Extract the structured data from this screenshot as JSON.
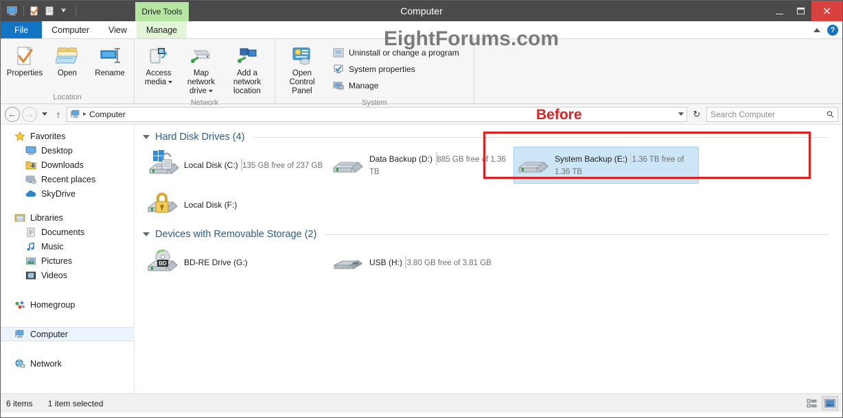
{
  "window": {
    "title": "Computer",
    "contextual_tab": "Drive Tools",
    "watermark": "EightForums.com",
    "minimize": "minimize-button",
    "maximize": "maximize-button",
    "close": "×"
  },
  "tabs": [
    {
      "label": "File",
      "type": "file"
    },
    {
      "label": "Computer",
      "type": "active"
    },
    {
      "label": "View",
      "type": "normal"
    },
    {
      "label": "Manage",
      "type": "contextual"
    }
  ],
  "ribbon": {
    "groups": [
      {
        "label": "Location",
        "buttons": [
          {
            "label": "Properties",
            "icon": "properties-icon",
            "dropdown": false
          },
          {
            "label": "Open",
            "icon": "open-folder-icon",
            "dropdown": false
          },
          {
            "label": "Rename",
            "icon": "rename-icon",
            "dropdown": false
          }
        ]
      },
      {
        "label": "Network",
        "buttons": [
          {
            "label": "Access media",
            "icon": "access-media-icon",
            "dropdown": true
          },
          {
            "label": "Map network drive",
            "icon": "map-network-drive-icon",
            "dropdown": true
          },
          {
            "label": "Add a network location",
            "icon": "add-network-location-icon",
            "dropdown": false
          }
        ]
      },
      {
        "label": "System",
        "buttons": [
          {
            "label": "Open Control Panel",
            "icon": "control-panel-icon",
            "dropdown": false
          }
        ],
        "small_buttons": [
          {
            "label": "Uninstall or change a program",
            "icon": "uninstall-program-icon"
          },
          {
            "label": "System properties",
            "icon": "system-properties-icon"
          },
          {
            "label": "Manage",
            "icon": "computer-manage-icon"
          }
        ]
      }
    ]
  },
  "addressbar": {
    "back": "back-button",
    "forward": "forward-button",
    "recent": "recent-locations-dropdown",
    "up": "up-one-level-button",
    "breadcrumb_icon": "computer-icon",
    "breadcrumb": "Computer",
    "separator": "▸",
    "refresh": "↻",
    "search_placeholder": "Search Computer",
    "search_value": ""
  },
  "navpane": {
    "sections": [
      {
        "header": {
          "label": "Favorites",
          "icon": "star-icon"
        },
        "items": [
          {
            "label": "Desktop",
            "icon": "desktop-icon"
          },
          {
            "label": "Downloads",
            "icon": "downloads-icon"
          },
          {
            "label": "Recent places",
            "icon": "recent-places-icon"
          },
          {
            "label": "SkyDrive",
            "icon": "skydrive-icon"
          }
        ]
      },
      {
        "header": {
          "label": "Libraries",
          "icon": "libraries-icon"
        },
        "items": [
          {
            "label": "Documents",
            "icon": "documents-icon"
          },
          {
            "label": "Music",
            "icon": "music-icon"
          },
          {
            "label": "Pictures",
            "icon": "pictures-icon"
          },
          {
            "label": "Videos",
            "icon": "videos-icon"
          }
        ]
      },
      {
        "header": {
          "label": "Homegroup",
          "icon": "homegroup-icon"
        },
        "items": []
      },
      {
        "header": {
          "label": "Computer",
          "icon": "computer-icon",
          "selected": true
        },
        "items": []
      },
      {
        "header": {
          "label": "Network",
          "icon": "network-icon"
        },
        "items": []
      }
    ]
  },
  "content": {
    "groups": [
      {
        "title": "Hard Disk Drives (4)",
        "drives": [
          {
            "name": "Local Disk (C:)",
            "capacity_text": "135 GB free of 237 GB",
            "used_percent": 43,
            "icon": "hard-drive-icon",
            "badge": "bitlocker-unlocked-icon",
            "windows_logo": true,
            "selected": false,
            "has_bar": true
          },
          {
            "name": "Data Backup (D:)",
            "capacity_text": "885 GB free of 1.36 TB",
            "used_percent": 36,
            "icon": "hard-drive-icon",
            "badge": "",
            "windows_logo": false,
            "selected": false,
            "has_bar": true
          },
          {
            "name": "System Backup (E:)",
            "capacity_text": "1.36 TB free of 1.36 TB",
            "used_percent": 0,
            "icon": "hard-drive-icon",
            "badge": "",
            "windows_logo": false,
            "selected": true,
            "has_bar": true
          },
          {
            "name": "Local Disk (F:)",
            "capacity_text": "",
            "used_percent": 0,
            "icon": "hard-drive-icon",
            "badge": "bitlocker-locked-icon",
            "windows_logo": false,
            "selected": false,
            "has_bar": false
          }
        ]
      },
      {
        "title": "Devices with Removable Storage (2)",
        "drives": [
          {
            "name": "BD-RE Drive (G:)",
            "capacity_text": "",
            "used_percent": 0,
            "icon": "optical-drive-icon",
            "badge": "bd-badge",
            "windows_logo": false,
            "selected": false,
            "has_bar": false
          },
          {
            "name": "USB (H:)",
            "capacity_text": "3.80 GB free of 3.81 GB",
            "used_percent": 0,
            "icon": "usb-drive-icon",
            "badge": "",
            "windows_logo": false,
            "selected": false,
            "has_bar": true
          }
        ]
      }
    ],
    "annotation": {
      "label": "Before",
      "color": "#e21f1f"
    }
  },
  "statusbar": {
    "item_count": "6 items",
    "selection": "1 item selected",
    "view_details": "details-view-button",
    "view_large_icons": "large-icons-view-button"
  },
  "colors": {
    "accent": "#1175c4",
    "bar_fill": "#1f96e0",
    "selection": "#cce5f7",
    "annotation_red": "#e21f1f",
    "contextual_green": "#b5e6a1",
    "titlebar": "#4a4a4a"
  }
}
